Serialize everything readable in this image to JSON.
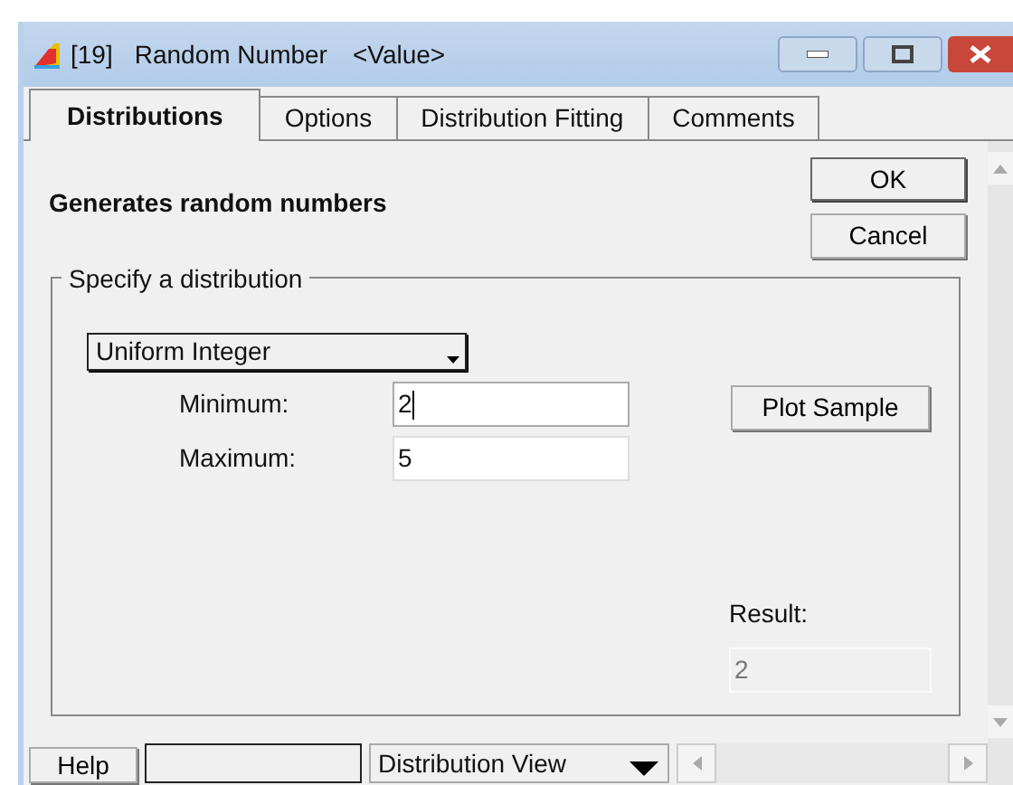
{
  "window": {
    "title_index": "[19]",
    "title": "Random Number",
    "title_suffix": "<Value>"
  },
  "tabs": [
    {
      "label": "Distributions",
      "selected": true
    },
    {
      "label": "Options",
      "selected": false
    },
    {
      "label": "Distribution Fitting",
      "selected": false
    },
    {
      "label": "Comments",
      "selected": false
    }
  ],
  "description": "Generates random numbers",
  "buttons": {
    "ok": "OK",
    "cancel": "Cancel"
  },
  "group": {
    "legend": "Specify a distribution",
    "distribution": "Uniform Integer",
    "fields": [
      {
        "label": "Minimum:",
        "value": "2",
        "focused": true
      },
      {
        "label": "Maximum:",
        "value": "5",
        "focused": false
      }
    ],
    "plot_button": "Plot Sample",
    "result_label": "Result:",
    "result_value": "2"
  },
  "bottom_bar": {
    "help": "Help",
    "view": "Distribution View"
  }
}
